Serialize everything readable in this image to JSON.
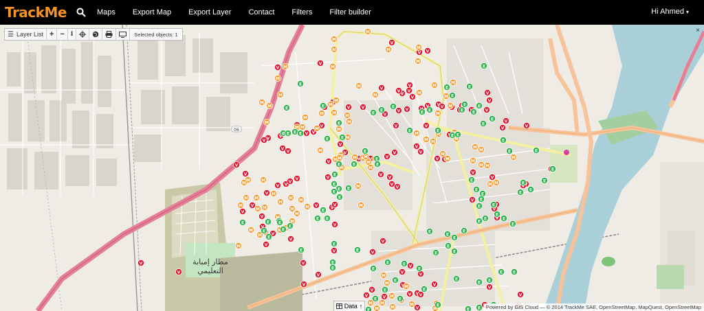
{
  "app": {
    "logo": "TrackMe"
  },
  "navbar": {
    "menu": [
      "Maps",
      "Export Map",
      "Export Layer",
      "Contact",
      "Filters",
      "Filter builder"
    ],
    "user_label": "Hi Ahmed",
    "caret": "▾"
  },
  "toolbar": {
    "layer_list_label": "Layer List",
    "zoom_in": "+",
    "zoom_out": "−",
    "info": "i",
    "selected_label": "Selected objects: 1"
  },
  "map": {
    "airport_label_line1": "مطار إمبابة",
    "airport_label_line2": "التعليمي",
    "road_badge": "06",
    "hide_button": "×"
  },
  "data_tab": {
    "label": "Data"
  },
  "attribution": "Powered by GIS Cloud — © 2014 TrackMe SAE, OpenStreetMap, MapQuest, OpenStreetMap",
  "marker_types": {
    "red": {
      "letter": "V",
      "color": "#e8112d"
    },
    "orange": {
      "letter": "M",
      "color": "#f39a2f"
    },
    "green": {
      "letter": "E",
      "color": "#2bb24c"
    }
  }
}
